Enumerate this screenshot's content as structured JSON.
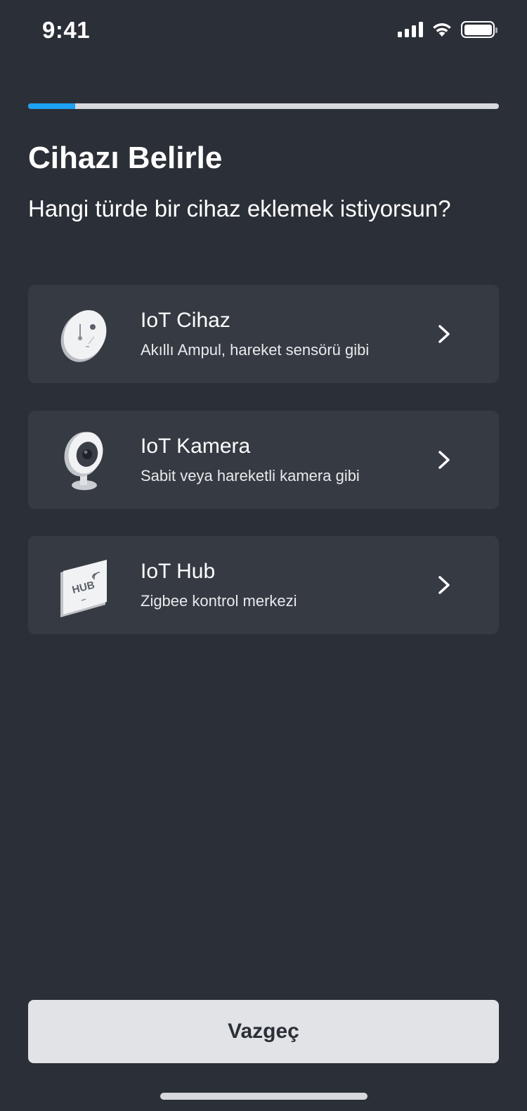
{
  "status_bar": {
    "time": "9:41",
    "icons": [
      "cellular-signal-icon",
      "wifi-icon",
      "battery-icon"
    ]
  },
  "progress": {
    "fraction": 0.1
  },
  "header": {
    "title": "Cihazı Belirle",
    "subtitle": "Hangi türde bir cihaz eklemek istiyorsun?"
  },
  "options": [
    {
      "title": "IoT Cihaz",
      "description": "Akıllı Ampul, hareket sensörü gibi",
      "icon": "sensor-device-icon"
    },
    {
      "title": "IoT Kamera",
      "description": "Sabit veya hareketli kamera gibi",
      "icon": "camera-device-icon"
    },
    {
      "title": "IoT Hub",
      "description": "Zigbee kontrol merkezi",
      "icon": "hub-device-icon",
      "icon_text": "HUB"
    }
  ],
  "footer": {
    "cancel_label": "Vazgeç"
  },
  "colors": {
    "background": "#2b2f37",
    "card": "#363a43",
    "accent": "#1da1f2",
    "button": "#e1e3e7"
  }
}
